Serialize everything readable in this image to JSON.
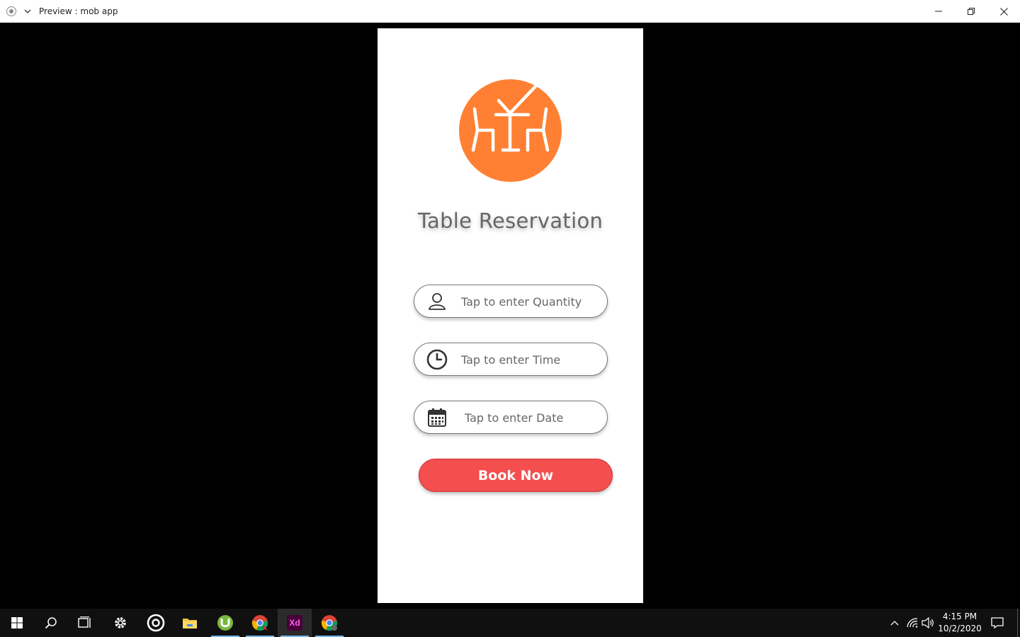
{
  "window": {
    "title": "Preview : mob app"
  },
  "app": {
    "title": "Table Reservation",
    "fields": {
      "quantity": {
        "placeholder": "Tap to enter Quantity",
        "icon": "user-icon"
      },
      "time": {
        "placeholder": "Tap to enter Time",
        "icon": "clock-icon"
      },
      "date": {
        "placeholder": "Tap to enter Date",
        "icon": "calendar-icon"
      }
    },
    "book_button": "Book Now",
    "colors": {
      "logo_orange": "#ff8033",
      "button_red": "#f44e4e"
    }
  },
  "taskbar": {
    "apps": [
      "start-icon",
      "search-icon",
      "task-view-icon",
      "settings-icon",
      "groove-icon",
      "file-explorer-icon",
      "utorrent-icon",
      "chrome-icon",
      "adobe-xd-icon",
      "chrome-icon"
    ],
    "xd_label": "Xd",
    "time": "4:15 PM",
    "date": "10/2/2020"
  }
}
